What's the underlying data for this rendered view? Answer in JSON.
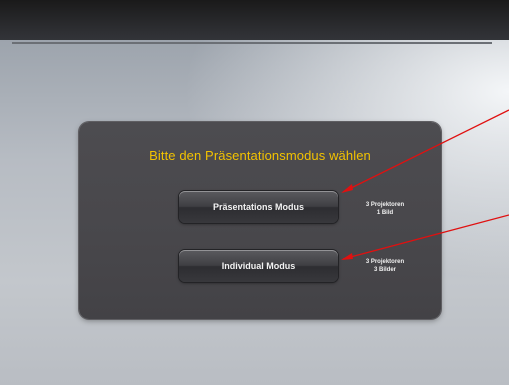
{
  "dialog": {
    "title": "Bitte den Präsentationsmodus wählen"
  },
  "modes": [
    {
      "label": "Präsentations Modus",
      "info_line1": "3 Projektoren",
      "info_line2": "1 Bild"
    },
    {
      "label": "Individual Modus",
      "info_line1": "3 Projektoren",
      "info_line2": "3 Bilder"
    }
  ],
  "annotation": {
    "arrow_color": "#e01010"
  },
  "colors": {
    "title": "#f2c200",
    "panel": "#4a494d",
    "screen": "#c3c7cc"
  }
}
